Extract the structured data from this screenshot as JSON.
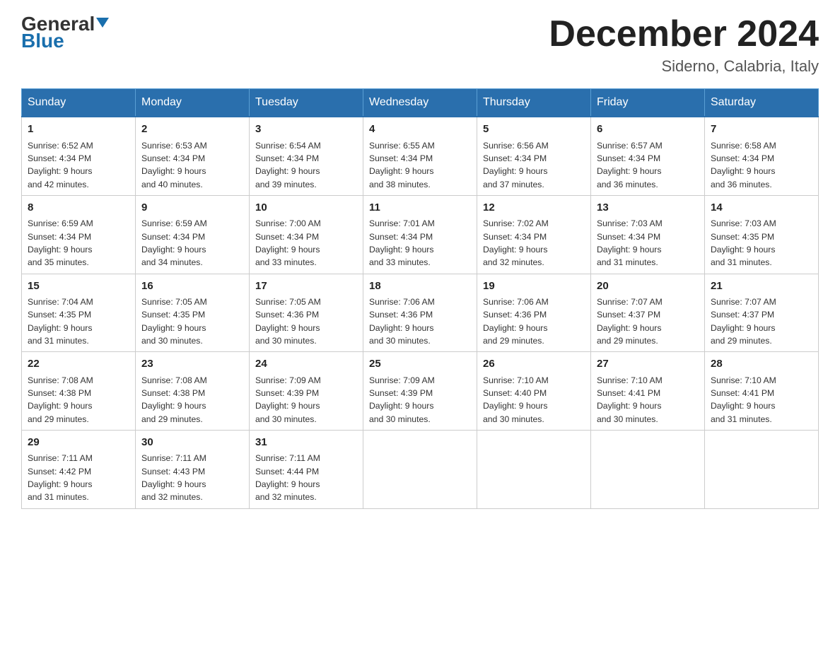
{
  "header": {
    "logo_general": "General",
    "logo_blue": "Blue",
    "month_title": "December 2024",
    "location": "Siderno, Calabria, Italy"
  },
  "days_of_week": [
    "Sunday",
    "Monday",
    "Tuesday",
    "Wednesday",
    "Thursday",
    "Friday",
    "Saturday"
  ],
  "weeks": [
    [
      {
        "day": "1",
        "sunrise": "6:52 AM",
        "sunset": "4:34 PM",
        "daylight": "9 hours and 42 minutes."
      },
      {
        "day": "2",
        "sunrise": "6:53 AM",
        "sunset": "4:34 PM",
        "daylight": "9 hours and 40 minutes."
      },
      {
        "day": "3",
        "sunrise": "6:54 AM",
        "sunset": "4:34 PM",
        "daylight": "9 hours and 39 minutes."
      },
      {
        "day": "4",
        "sunrise": "6:55 AM",
        "sunset": "4:34 PM",
        "daylight": "9 hours and 38 minutes."
      },
      {
        "day": "5",
        "sunrise": "6:56 AM",
        "sunset": "4:34 PM",
        "daylight": "9 hours and 37 minutes."
      },
      {
        "day": "6",
        "sunrise": "6:57 AM",
        "sunset": "4:34 PM",
        "daylight": "9 hours and 36 minutes."
      },
      {
        "day": "7",
        "sunrise": "6:58 AM",
        "sunset": "4:34 PM",
        "daylight": "9 hours and 36 minutes."
      }
    ],
    [
      {
        "day": "8",
        "sunrise": "6:59 AM",
        "sunset": "4:34 PM",
        "daylight": "9 hours and 35 minutes."
      },
      {
        "day": "9",
        "sunrise": "6:59 AM",
        "sunset": "4:34 PM",
        "daylight": "9 hours and 34 minutes."
      },
      {
        "day": "10",
        "sunrise": "7:00 AM",
        "sunset": "4:34 PM",
        "daylight": "9 hours and 33 minutes."
      },
      {
        "day": "11",
        "sunrise": "7:01 AM",
        "sunset": "4:34 PM",
        "daylight": "9 hours and 33 minutes."
      },
      {
        "day": "12",
        "sunrise": "7:02 AM",
        "sunset": "4:34 PM",
        "daylight": "9 hours and 32 minutes."
      },
      {
        "day": "13",
        "sunrise": "7:03 AM",
        "sunset": "4:34 PM",
        "daylight": "9 hours and 31 minutes."
      },
      {
        "day": "14",
        "sunrise": "7:03 AM",
        "sunset": "4:35 PM",
        "daylight": "9 hours and 31 minutes."
      }
    ],
    [
      {
        "day": "15",
        "sunrise": "7:04 AM",
        "sunset": "4:35 PM",
        "daylight": "9 hours and 31 minutes."
      },
      {
        "day": "16",
        "sunrise": "7:05 AM",
        "sunset": "4:35 PM",
        "daylight": "9 hours and 30 minutes."
      },
      {
        "day": "17",
        "sunrise": "7:05 AM",
        "sunset": "4:36 PM",
        "daylight": "9 hours and 30 minutes."
      },
      {
        "day": "18",
        "sunrise": "7:06 AM",
        "sunset": "4:36 PM",
        "daylight": "9 hours and 30 minutes."
      },
      {
        "day": "19",
        "sunrise": "7:06 AM",
        "sunset": "4:36 PM",
        "daylight": "9 hours and 29 minutes."
      },
      {
        "day": "20",
        "sunrise": "7:07 AM",
        "sunset": "4:37 PM",
        "daylight": "9 hours and 29 minutes."
      },
      {
        "day": "21",
        "sunrise": "7:07 AM",
        "sunset": "4:37 PM",
        "daylight": "9 hours and 29 minutes."
      }
    ],
    [
      {
        "day": "22",
        "sunrise": "7:08 AM",
        "sunset": "4:38 PM",
        "daylight": "9 hours and 29 minutes."
      },
      {
        "day": "23",
        "sunrise": "7:08 AM",
        "sunset": "4:38 PM",
        "daylight": "9 hours and 29 minutes."
      },
      {
        "day": "24",
        "sunrise": "7:09 AM",
        "sunset": "4:39 PM",
        "daylight": "9 hours and 30 minutes."
      },
      {
        "day": "25",
        "sunrise": "7:09 AM",
        "sunset": "4:39 PM",
        "daylight": "9 hours and 30 minutes."
      },
      {
        "day": "26",
        "sunrise": "7:10 AM",
        "sunset": "4:40 PM",
        "daylight": "9 hours and 30 minutes."
      },
      {
        "day": "27",
        "sunrise": "7:10 AM",
        "sunset": "4:41 PM",
        "daylight": "9 hours and 30 minutes."
      },
      {
        "day": "28",
        "sunrise": "7:10 AM",
        "sunset": "4:41 PM",
        "daylight": "9 hours and 31 minutes."
      }
    ],
    [
      {
        "day": "29",
        "sunrise": "7:11 AM",
        "sunset": "4:42 PM",
        "daylight": "9 hours and 31 minutes."
      },
      {
        "day": "30",
        "sunrise": "7:11 AM",
        "sunset": "4:43 PM",
        "daylight": "9 hours and 32 minutes."
      },
      {
        "day": "31",
        "sunrise": "7:11 AM",
        "sunset": "4:44 PM",
        "daylight": "9 hours and 32 minutes."
      },
      null,
      null,
      null,
      null
    ]
  ],
  "labels": {
    "sunrise": "Sunrise:",
    "sunset": "Sunset:",
    "daylight": "Daylight:"
  }
}
